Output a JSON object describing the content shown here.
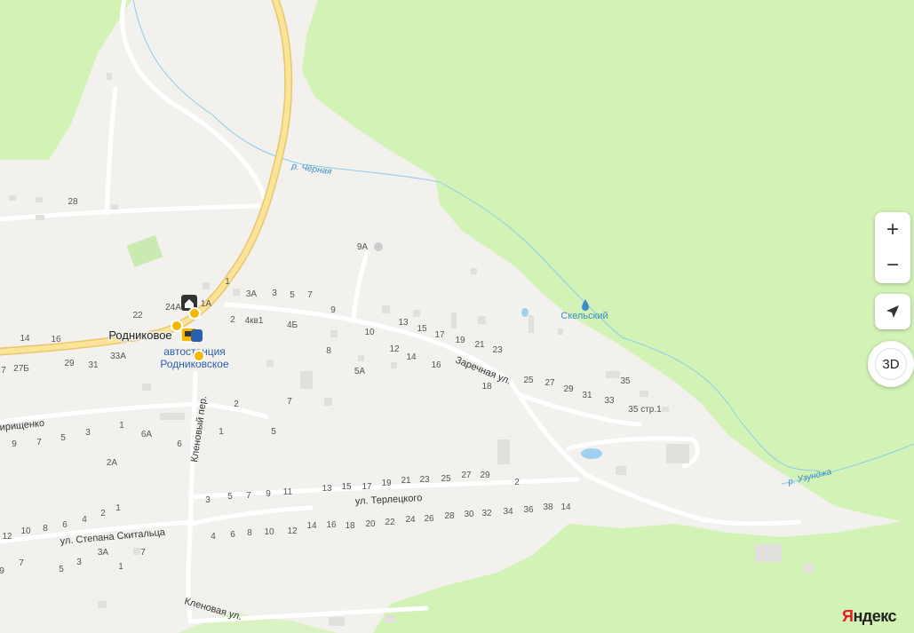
{
  "map": {
    "labels": {
      "settlement": "Родниковое",
      "bus_station_1": "автостанция",
      "bus_station_2": "Родниковское",
      "lake": "Скельский",
      "river_chernaya": "р. Чёрная",
      "river_uzundzha": "р. Узунджа",
      "street_zarechnaya": "Заречная ул.",
      "street_terletskogo": "ул. Терлецкого",
      "street_skitaltsa": "ул. Степана Скитальца",
      "street_klenoviy_per": "Кленовый пер.",
      "street_klenovaya": "Кленовая ул.",
      "street_grishchenko": "ирищенко"
    },
    "house_numbers": [
      "28",
      "9А",
      "1",
      "3А",
      "3",
      "5",
      "7",
      "9",
      "2",
      "4кв1",
      "4Б",
      "22",
      "24А",
      "1А",
      "13",
      "15",
      "17",
      "19",
      "21",
      "23",
      "10",
      "8",
      "12",
      "14",
      "16",
      "5А",
      "18",
      "25",
      "27",
      "29",
      "31",
      "33",
      "35",
      "35 стр.1",
      "14",
      "16",
      "29",
      "31",
      "33А",
      "27Б",
      "7",
      "2",
      "7",
      "5",
      "1",
      "6А",
      "6",
      "2А",
      "9",
      "7",
      "5",
      "3",
      "1",
      "3",
      "5",
      "7",
      "9",
      "11",
      "13",
      "15",
      "17",
      "19",
      "21",
      "23",
      "25",
      "27",
      "29",
      "2",
      "4",
      "6",
      "8",
      "10",
      "12",
      "14",
      "16",
      "18",
      "20",
      "22",
      "24",
      "26",
      "28",
      "30",
      "32",
      "34",
      "36",
      "38",
      "14",
      "12",
      "10",
      "8",
      "6",
      "4",
      "2",
      "1",
      "9",
      "7",
      "5",
      "3",
      "3А",
      "1",
      "7"
    ]
  },
  "controls": {
    "zoom_in": "+",
    "zoom_out": "−",
    "mode_3d": "3D"
  },
  "branding": {
    "logo_y": "Я",
    "logo_rest": "ндекс"
  },
  "colors": {
    "background": "#f2f1ee",
    "forest": "#d2f2b6",
    "road_main": "#fbe39a",
    "water": "#7ec0ee",
    "poi": "#f5b800"
  }
}
